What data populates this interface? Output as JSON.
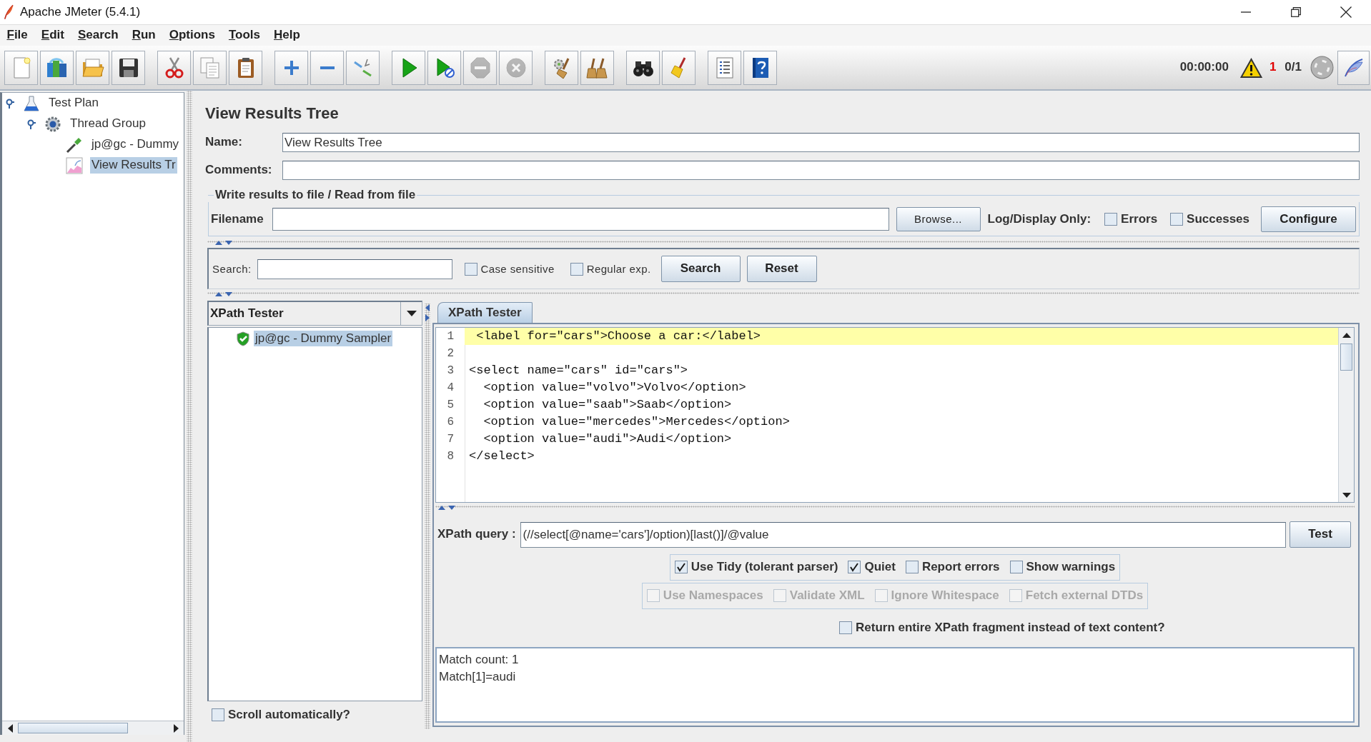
{
  "window": {
    "title": "Apache JMeter (5.4.1)"
  },
  "menu": [
    "File",
    "Edit",
    "Search",
    "Run",
    "Options",
    "Tools",
    "Help"
  ],
  "toolbar": [
    [
      {
        "kind": "new",
        "disabled": false
      },
      {
        "kind": "templates",
        "disabled": false
      },
      {
        "kind": "open",
        "disabled": false
      },
      {
        "kind": "save",
        "disabled": false
      }
    ],
    [
      {
        "kind": "cut",
        "disabled": false
      },
      {
        "kind": "copy",
        "disabled": false
      },
      {
        "kind": "paste",
        "disabled": false
      }
    ],
    [
      {
        "kind": "expand",
        "disabled": false
      },
      {
        "kind": "collapse",
        "disabled": false
      },
      {
        "kind": "toggle",
        "disabled": false
      }
    ],
    [
      {
        "kind": "start",
        "disabled": false
      },
      {
        "kind": "start_no_pauses",
        "disabled": false
      },
      {
        "kind": "stop",
        "disabled": true
      },
      {
        "kind": "shutdown",
        "disabled": true
      }
    ],
    [
      {
        "kind": "clear",
        "disabled": false
      },
      {
        "kind": "clear_all",
        "disabled": false
      }
    ],
    [
      {
        "kind": "search",
        "disabled": false
      },
      {
        "kind": "reset_search",
        "disabled": false
      }
    ],
    [
      {
        "kind": "function_helper",
        "disabled": false
      },
      {
        "kind": "help",
        "disabled": false
      }
    ]
  ],
  "status": {
    "timer": "00:00:00",
    "error_count": "1",
    "threads": "0/1"
  },
  "tree": [
    {
      "label": "Test Plan",
      "kind": "plan",
      "expanded": true,
      "selected": false,
      "children": [
        {
          "label": "Thread Group",
          "kind": "thread_group",
          "expanded": true,
          "selected": false,
          "children": [
            {
              "label": "jp@gc - Dummy",
              "kind": "sampler",
              "selected": false
            },
            {
              "label": "View Results Tr",
              "kind": "listener",
              "selected": true
            }
          ]
        }
      ]
    }
  ],
  "panel": {
    "title": "View Results Tree",
    "fields": [
      {
        "label": "Name:",
        "value": "View Results Tree"
      },
      {
        "label": "Comments:"
      }
    ]
  },
  "file_section": {
    "legend": "Write results to file / Read from file",
    "filename_label": "Filename",
    "browse_button": "Browse...",
    "log_label": "Log/Display Only:",
    "options": [
      {
        "label": "Errors",
        "checked": false
      },
      {
        "label": "Successes",
        "checked": false
      }
    ],
    "configure_button": "Configure"
  },
  "search_bar": {
    "label": "Search:",
    "options": [
      {
        "label": "Case sensitive",
        "checked": false
      },
      {
        "label": "Regular exp.",
        "checked": false
      }
    ],
    "buttons": [
      "Search",
      "Reset"
    ]
  },
  "results": {
    "renderer": "XPath Tester",
    "items": [
      {
        "label": "jp@gc - Dummy Sampler",
        "selected": true,
        "success": true
      }
    ],
    "scroll_option": {
      "label": "Scroll automatically?",
      "checked": false
    }
  },
  "tabs": [
    {
      "label": "XPath Tester",
      "selected": true
    }
  ],
  "editor": {
    "lines": [
      {
        "number": "1",
        "text": " <label for=\"cars\">Choose a car:</label>",
        "selected": true
      },
      {
        "number": "2",
        "selected": false
      },
      {
        "number": "3",
        "text": "<select name=\"cars\" id=\"cars\">",
        "selected": false
      },
      {
        "number": "4",
        "text": "  <option value=\"volvo\">Volvo</option>",
        "selected": false
      },
      {
        "number": "5",
        "text": "  <option value=\"saab\">Saab</option>",
        "selected": false
      },
      {
        "number": "6",
        "text": "  <option value=\"mercedes\">Mercedes</option>",
        "selected": false
      },
      {
        "number": "7",
        "text": "  <option value=\"audi\">Audi</option>",
        "selected": false
      },
      {
        "number": "8",
        "text": "</select>",
        "selected": false
      }
    ]
  },
  "xpath": {
    "label": "XPath query :",
    "value": "(//select[@name='cars']/option)[last()]/@value",
    "button": "Test",
    "option_rows": [
      [
        {
          "label": "Use Tidy (tolerant parser)",
          "checked": true,
          "disabled": false
        },
        {
          "label": "Quiet",
          "checked": true,
          "disabled": false
        },
        {
          "label": "Report errors",
          "checked": false,
          "disabled": false
        },
        {
          "label": "Show warnings",
          "checked": false,
          "disabled": false
        }
      ],
      [
        {
          "label": "Use Namespaces",
          "checked": false,
          "disabled": true
        },
        {
          "label": "Validate XML",
          "checked": false,
          "disabled": true
        },
        {
          "label": "Ignore Whitespace",
          "checked": false,
          "disabled": true
        },
        {
          "label": "Fetch external DTDs",
          "checked": false,
          "disabled": true
        }
      ]
    ],
    "fragment_option": {
      "label": "Return entire XPath fragment instead of text content?",
      "checked": false
    },
    "result_lines": [
      "Match count: 1",
      "Match[1]=audi"
    ]
  }
}
